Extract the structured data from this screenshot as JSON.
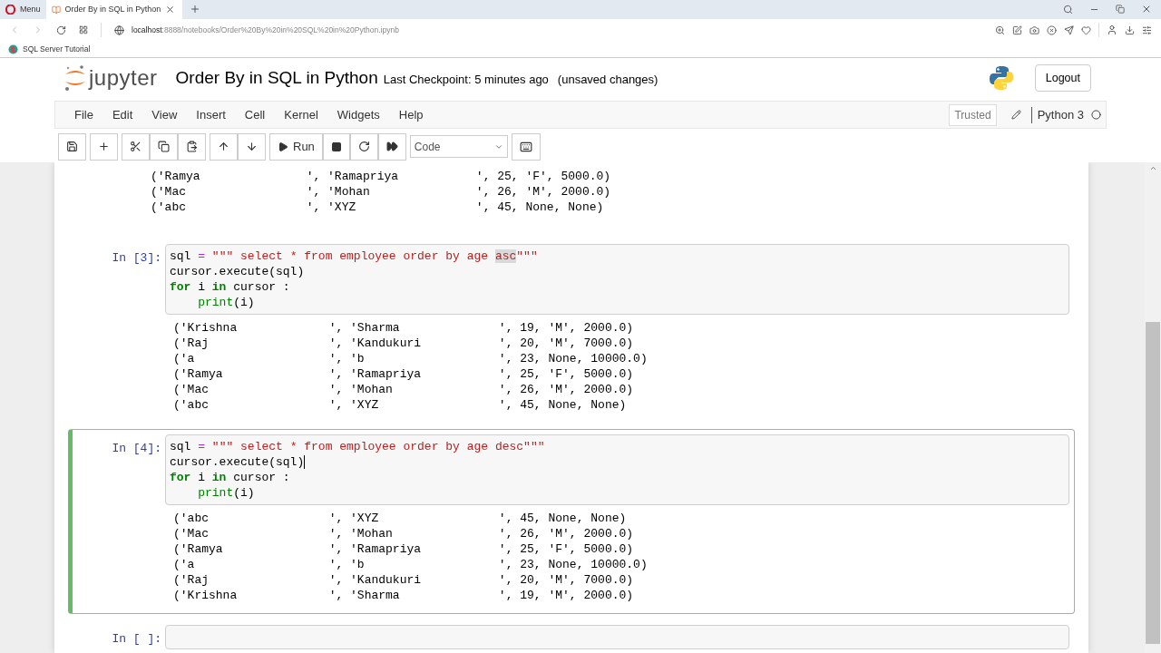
{
  "browser": {
    "tabs": [
      {
        "label": "Menu",
        "selected": false
      },
      {
        "label": "Order By in SQL in Python",
        "selected": true
      }
    ],
    "address": {
      "host": "localhost",
      "path": ":8888/notebooks/Order%20By%20in%20SQL%20in%20Python.ipynb"
    },
    "bookmarks": [
      "SQL Server Tutorial"
    ]
  },
  "header": {
    "logo": "jupyter",
    "title": "Order By in SQL in Python",
    "checkpoint": "Last Checkpoint: 5 minutes ago",
    "status": "(unsaved changes)",
    "logout": "Logout"
  },
  "menu": [
    "File",
    "Edit",
    "View",
    "Insert",
    "Cell",
    "Kernel",
    "Widgets",
    "Help"
  ],
  "kernel": {
    "trusted": "Trusted",
    "name": "Python 3"
  },
  "toolbar": {
    "run": "Run",
    "cell_type": "Code"
  },
  "cells": [
    {
      "kind": "output",
      "output": [
        "('Ramya               ', 'Ramapriya           ', 25, 'F', 5000.0)",
        "('Mac                 ', 'Mohan               ', 26, 'M', 2000.0)",
        "('abc                 ', 'XYZ                 ', 45, None, None)"
      ]
    },
    {
      "kind": "code",
      "selected": false,
      "prompt": "In [3]:",
      "input": [
        [
          {
            "kind": "plain",
            "text": "sql "
          },
          {
            "kind": "operator",
            "text": "="
          },
          {
            "kind": "string",
            "text": " \"\"\" select * from employee order by age "
          },
          {
            "kind": "match",
            "text": "asc"
          },
          {
            "kind": "string",
            "text": "\"\"\""
          }
        ],
        [
          {
            "kind": "plain",
            "text": "cursor.execute(sql)"
          }
        ],
        [
          {
            "kind": "keyword",
            "text": "for"
          },
          {
            "kind": "plain",
            "text": " i "
          },
          {
            "kind": "keyword",
            "text": "in"
          },
          {
            "kind": "plain",
            "text": " cursor :"
          }
        ],
        [
          {
            "kind": "builtin",
            "text": "    print"
          },
          {
            "kind": "plain",
            "text": "(i)"
          }
        ]
      ],
      "output": [
        "('Krishna             ', 'Sharma              ', 19, 'M', 2000.0)",
        "('Raj                 ', 'Kandukuri           ', 20, 'M', 7000.0)",
        "('a                   ', 'b                   ', 23, None, 10000.0)",
        "('Ramya               ', 'Ramapriya           ', 25, 'F', 5000.0)",
        "('Mac                 ', 'Mohan               ', 26, 'M', 2000.0)",
        "('abc                 ', 'XYZ                 ', 45, None, None)"
      ]
    },
    {
      "kind": "code",
      "selected": true,
      "prompt": "In [4]:",
      "input": [
        [
          {
            "kind": "plain",
            "text": "sql "
          },
          {
            "kind": "operator",
            "text": "="
          },
          {
            "kind": "string",
            "text": " \"\"\" select * from employee order by age desc\"\"\""
          }
        ],
        [
          {
            "kind": "plain",
            "text": "cursor.execute(sql)"
          },
          {
            "kind": "caret"
          }
        ],
        [
          {
            "kind": "keyword",
            "text": "for"
          },
          {
            "kind": "plain",
            "text": " i "
          },
          {
            "kind": "keyword",
            "text": "in"
          },
          {
            "kind": "plain",
            "text": " cursor :"
          }
        ],
        [
          {
            "kind": "builtin",
            "text": "    print"
          },
          {
            "kind": "plain",
            "text": "(i)"
          }
        ]
      ],
      "output": [
        "('abc                 ', 'XYZ                 ', 45, None, None)",
        "('Mac                 ', 'Mohan               ', 26, 'M', 2000.0)",
        "('Ramya               ', 'Ramapriya           ', 25, 'F', 5000.0)",
        "('a                   ', 'b                   ', 23, None, 10000.0)",
        "('Raj                 ', 'Kandukuri           ', 20, 'M', 7000.0)",
        "('Krishna             ', 'Sharma              ', 19, 'M', 2000.0)"
      ]
    },
    {
      "kind": "code",
      "selected": false,
      "prompt": "In [ ]:"
    }
  ]
}
